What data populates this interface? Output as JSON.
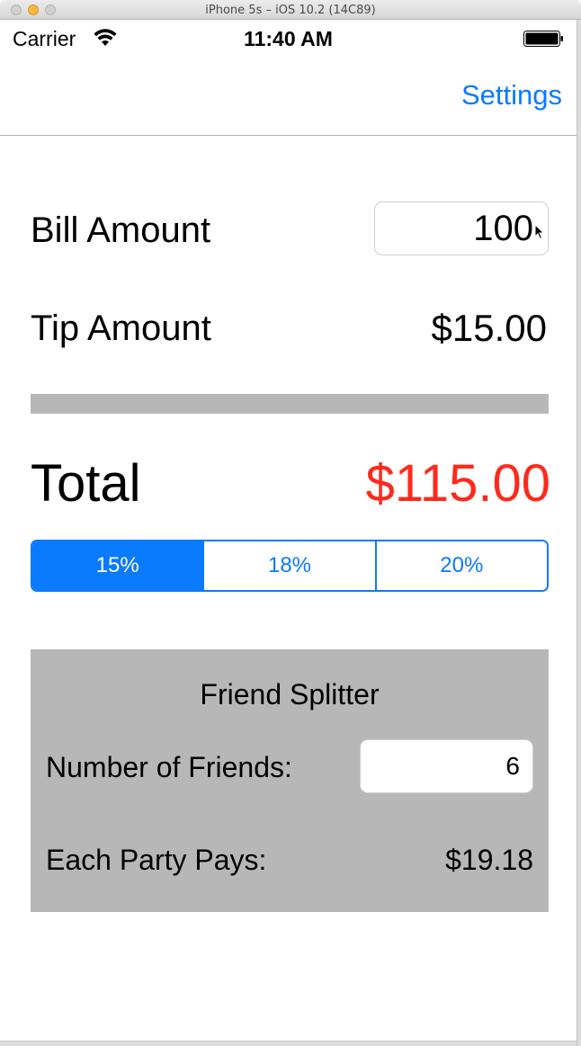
{
  "window": {
    "title": "iPhone 5s – iOS 10.2 (14C89)"
  },
  "status_bar": {
    "carrier": "Carrier",
    "time": "11:40 AM",
    "wifi_icon": "wifi-icon",
    "battery_icon": "battery-icon"
  },
  "nav": {
    "settings_label": "Settings"
  },
  "bill": {
    "label": "Bill Amount",
    "value": "100"
  },
  "tip": {
    "label": "Tip Amount",
    "value": "$15.00"
  },
  "total": {
    "label": "Total",
    "value": "$115.00"
  },
  "tip_options": {
    "segments": [
      "15%",
      "18%",
      "20%"
    ],
    "selected": "15%"
  },
  "splitter": {
    "title": "Friend Splitter",
    "friends_label": "Number of Friends:",
    "friends_value": "6",
    "pays_label": "Each Party Pays:",
    "pays_value": "$19.18"
  },
  "colors": {
    "accent": "#0a7aff",
    "total_red": "#fc2a1c",
    "panel_gray": "#b7b7b7"
  }
}
